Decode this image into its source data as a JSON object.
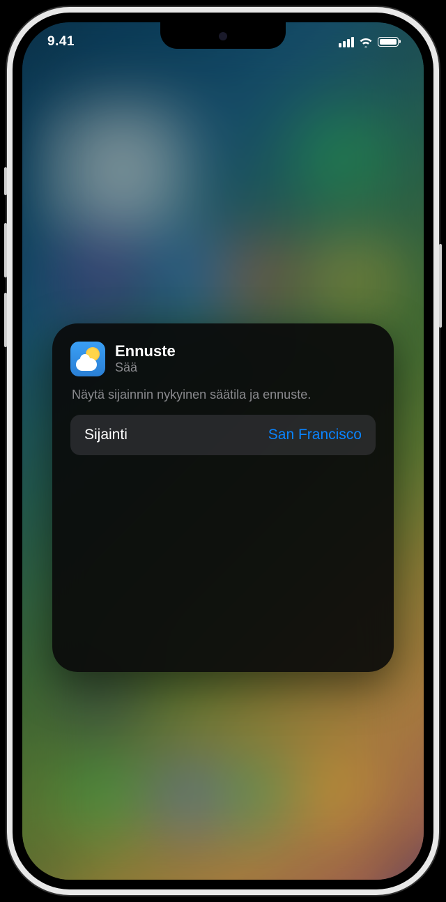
{
  "status": {
    "time": "9.41"
  },
  "widget": {
    "title": "Ennuste",
    "app_name": "Sää",
    "description": "Näytä sijainnin nykyinen säätila ja ennuste.",
    "option": {
      "label": "Sijainti",
      "value": "San Francisco"
    }
  }
}
